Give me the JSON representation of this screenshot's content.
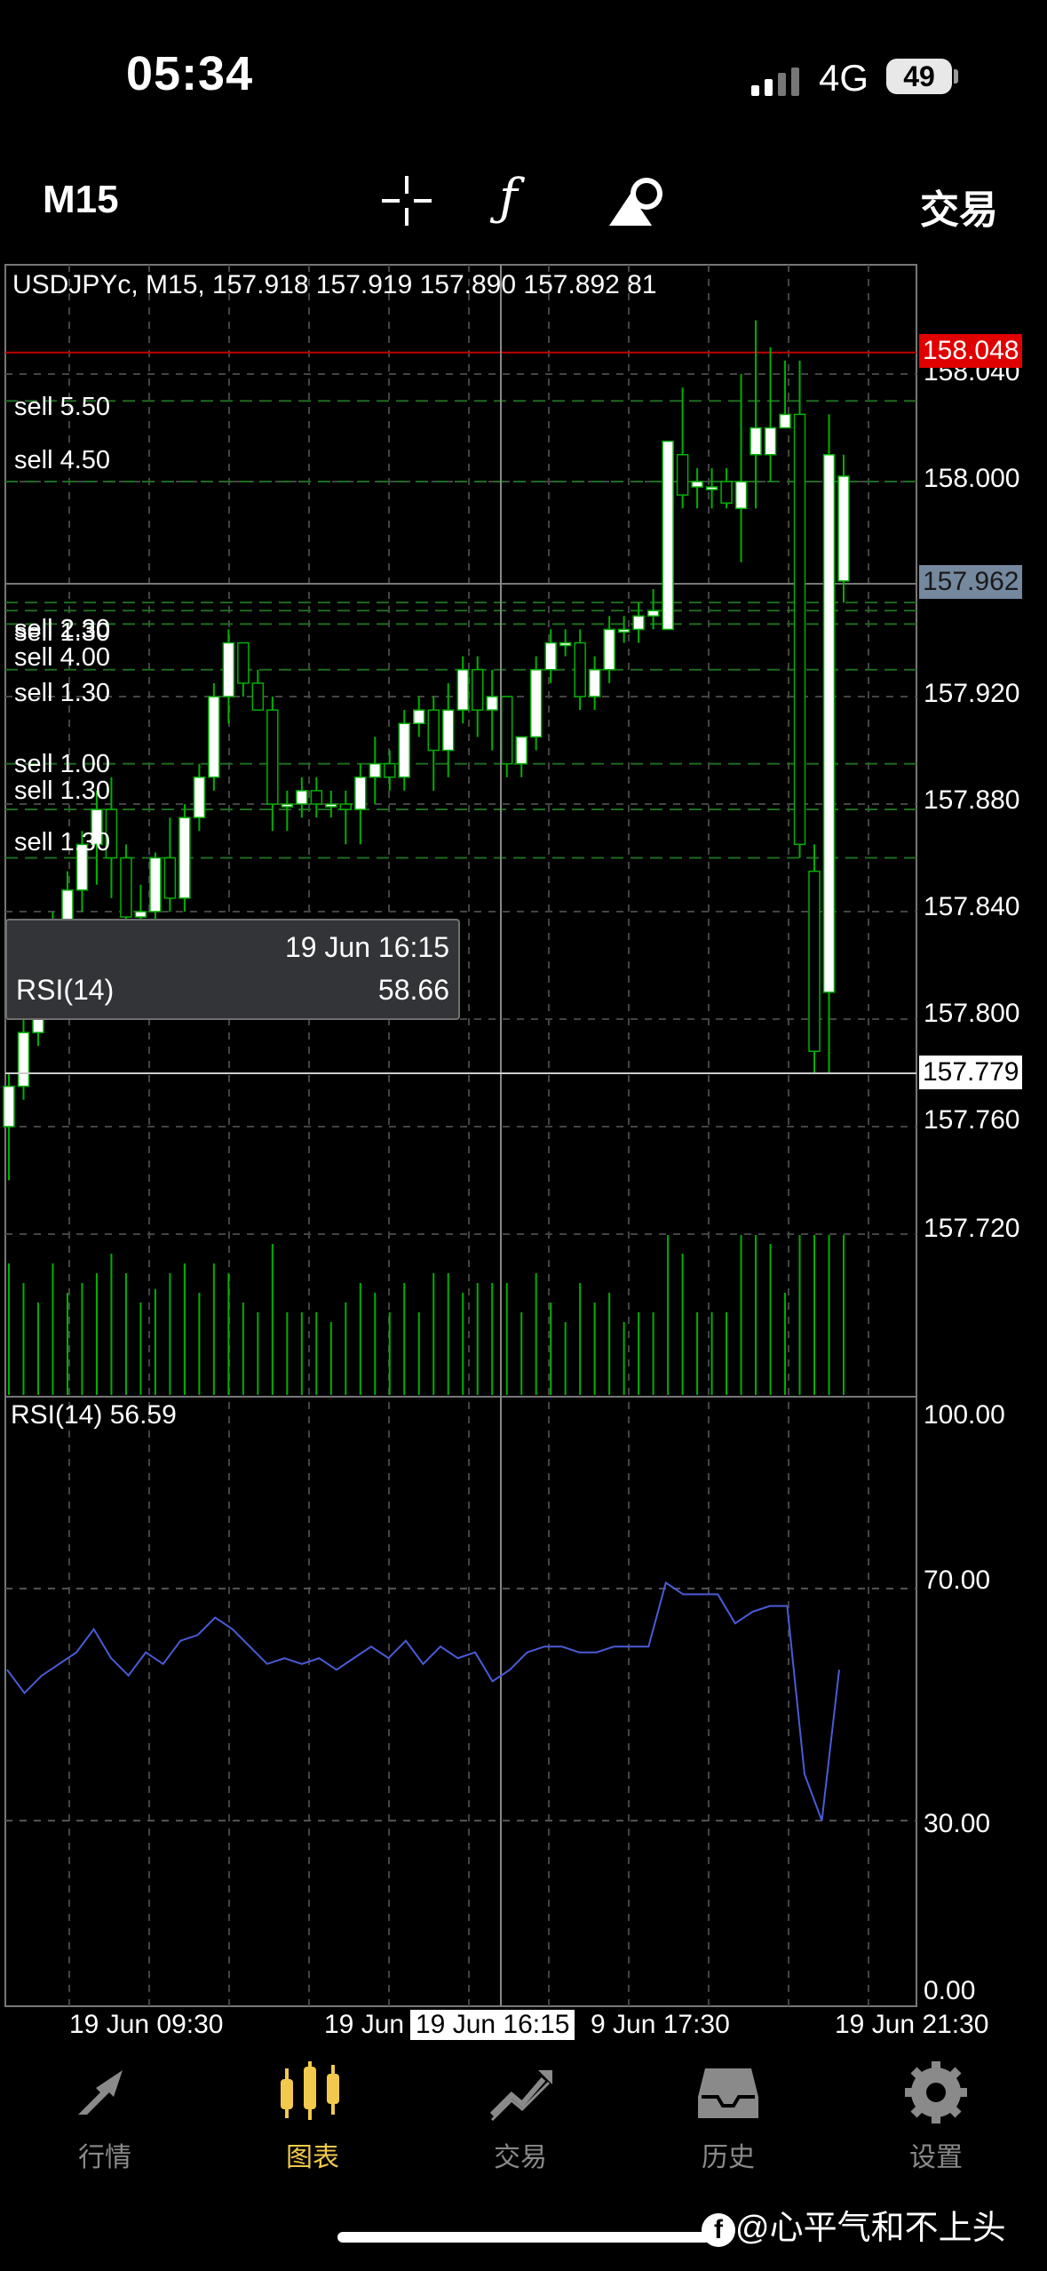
{
  "status_bar": {
    "time": "05:34",
    "network": "4G",
    "battery": "49"
  },
  "toolbar": {
    "timeframe": "M15",
    "trade_label": "交易",
    "crosshair_icon": "crosshair-icon",
    "indicator_icon": "function-icon",
    "objects_icon": "shapes-icon"
  },
  "chart": {
    "title": "USDJPYc, M15, 157.918 157.919 157.890 157.892 81",
    "title_overlay": "sell 5.50",
    "sell_orders": [
      {
        "label": "sell 5.50",
        "price": 158.03
      },
      {
        "label": "sell 4.50",
        "price": 158.0
      },
      {
        "label": "sell 2.30",
        "price": 157.955
      },
      {
        "label": "sell 1.30",
        "price": 157.952
      },
      {
        "label": "sell 4.00",
        "price": 157.947
      },
      {
        "label": "sell 1.30",
        "price": 157.93
      },
      {
        "label": "sell 1.00",
        "price": 157.895
      },
      {
        "label": "sell 1.30",
        "price": 157.878
      },
      {
        "label": "sell 1.30",
        "price": 157.86
      }
    ],
    "price_axis": [
      "158.040",
      "158.000",
      "157.920",
      "157.880",
      "157.840",
      "157.800",
      "157.760",
      "157.720"
    ],
    "ask_price": "158.048",
    "bid_price": "157.962",
    "crosshair_price": "157.779",
    "time_axis": [
      "19 Jun 09:30",
      "19 Jun",
      "9 Jun 17:30",
      "19 Jun 21:30"
    ],
    "crosshair_time": "19 Jun 16:15",
    "tooltip": {
      "date": "19 Jun 16:15",
      "name": "RSI(14)",
      "value": "58.66"
    },
    "rsi_title": "RSI(14) 56.59",
    "rsi_axis": [
      "100.00",
      "70.00",
      "30.00",
      "0.00"
    ],
    "colors": {
      "bull": "#ffffff",
      "bear": "#000000",
      "wick": "#00b000",
      "ask_line": "#c00000",
      "rsi_line": "#4a5bd6",
      "grid": "#3a3a3a"
    }
  },
  "chart_data": {
    "type": "candlestick",
    "symbol": "USDJPYc",
    "timeframe": "M15",
    "ylim": [
      157.7,
      158.06
    ],
    "candles": [
      [
        157.76,
        157.78,
        157.74,
        157.775
      ],
      [
        157.775,
        157.8,
        157.77,
        157.795
      ],
      [
        157.795,
        157.81,
        157.79,
        157.81
      ],
      [
        157.81,
        157.84,
        157.8,
        157.835
      ],
      [
        157.835,
        157.855,
        157.83,
        157.848
      ],
      [
        157.848,
        157.87,
        157.84,
        157.865
      ],
      [
        157.865,
        157.885,
        157.85,
        157.878
      ],
      [
        157.878,
        157.89,
        157.845,
        157.86
      ],
      [
        157.86,
        157.865,
        157.83,
        157.838
      ],
      [
        157.838,
        157.85,
        157.83,
        157.84
      ],
      [
        157.84,
        157.862,
        157.835,
        157.86
      ],
      [
        157.86,
        157.875,
        157.84,
        157.845
      ],
      [
        157.845,
        157.88,
        157.84,
        157.875
      ],
      [
        157.875,
        157.895,
        157.87,
        157.89
      ],
      [
        157.89,
        157.925,
        157.885,
        157.92
      ],
      [
        157.92,
        157.945,
        157.91,
        157.94
      ],
      [
        157.94,
        157.94,
        157.92,
        157.925
      ],
      [
        157.925,
        157.93,
        157.915,
        157.915
      ],
      [
        157.915,
        157.92,
        157.87,
        157.88
      ],
      [
        157.88,
        157.885,
        157.87,
        157.88
      ],
      [
        157.88,
        157.89,
        157.875,
        157.885
      ],
      [
        157.885,
        157.89,
        157.875,
        157.88
      ],
      [
        157.88,
        157.885,
        157.875,
        157.88
      ],
      [
        157.88,
        157.885,
        157.865,
        157.878
      ],
      [
        157.878,
        157.895,
        157.865,
        157.89
      ],
      [
        157.89,
        157.905,
        157.88,
        157.895
      ],
      [
        157.895,
        157.9,
        157.885,
        157.89
      ],
      [
        157.89,
        157.915,
        157.885,
        157.91
      ],
      [
        157.91,
        157.92,
        157.905,
        157.915
      ],
      [
        157.915,
        157.92,
        157.885,
        157.9
      ],
      [
        157.9,
        157.925,
        157.89,
        157.915
      ],
      [
        157.915,
        157.935,
        157.91,
        157.93
      ],
      [
        157.93,
        157.935,
        157.905,
        157.915
      ],
      [
        157.915,
        157.93,
        157.9,
        157.92
      ],
      [
        157.92,
        157.92,
        157.89,
        157.895
      ],
      [
        157.895,
        157.905,
        157.89,
        157.905
      ],
      [
        157.905,
        157.935,
        157.9,
        157.93
      ],
      [
        157.93,
        157.945,
        157.925,
        157.94
      ],
      [
        157.94,
        157.945,
        157.935,
        157.94
      ],
      [
        157.94,
        157.945,
        157.915,
        157.92
      ],
      [
        157.92,
        157.935,
        157.915,
        157.93
      ],
      [
        157.93,
        157.95,
        157.925,
        157.945
      ],
      [
        157.945,
        157.95,
        157.94,
        157.945
      ],
      [
        157.945,
        157.955,
        157.94,
        157.95
      ],
      [
        157.95,
        157.96,
        157.945,
        157.952
      ],
      [
        157.945,
        158.015,
        157.945,
        158.015
      ],
      [
        158.01,
        158.035,
        157.99,
        157.995
      ],
      [
        157.998,
        158.005,
        157.99,
        158.0
      ],
      [
        157.998,
        158.005,
        157.99,
        157.998
      ],
      [
        158.0,
        158.005,
        157.99,
        157.992
      ],
      [
        157.99,
        158.04,
        157.97,
        158.0
      ],
      [
        158.01,
        158.06,
        157.99,
        158.02
      ],
      [
        158.01,
        158.05,
        158.0,
        158.02
      ],
      [
        158.02,
        158.045,
        158.02,
        158.025
      ],
      [
        158.025,
        158.045,
        157.86,
        157.865
      ],
      [
        157.855,
        157.865,
        157.78,
        157.788
      ],
      [
        157.81,
        158.025,
        157.78,
        158.01
      ],
      [
        157.963,
        158.01,
        157.955,
        158.002
      ]
    ],
    "rsi": [
      56,
      52,
      55,
      57,
      59,
      63,
      58,
      55,
      59,
      57,
      61,
      62,
      65,
      63,
      60,
      57,
      58,
      57,
      58,
      56,
      58,
      60,
      58,
      61,
      57,
      60,
      58,
      59,
      54,
      56,
      59,
      60,
      60,
      59,
      59,
      60,
      60,
      60,
      71,
      69,
      69,
      69,
      64,
      66,
      67,
      67,
      38,
      30,
      56
    ],
    "rsi_levels": [
      70,
      30
    ],
    "rsi_ylim": [
      0,
      100
    ]
  },
  "nav": [
    {
      "label": "行情",
      "icon": "quotes-icon",
      "active": false
    },
    {
      "label": "图表",
      "icon": "chart-icon",
      "active": true
    },
    {
      "label": "交易",
      "icon": "trade-icon",
      "active": false
    },
    {
      "label": "历史",
      "icon": "history-icon",
      "active": false
    },
    {
      "label": "设置",
      "icon": "settings-icon",
      "active": false
    }
  ],
  "watermark": "@心平气和不上头"
}
